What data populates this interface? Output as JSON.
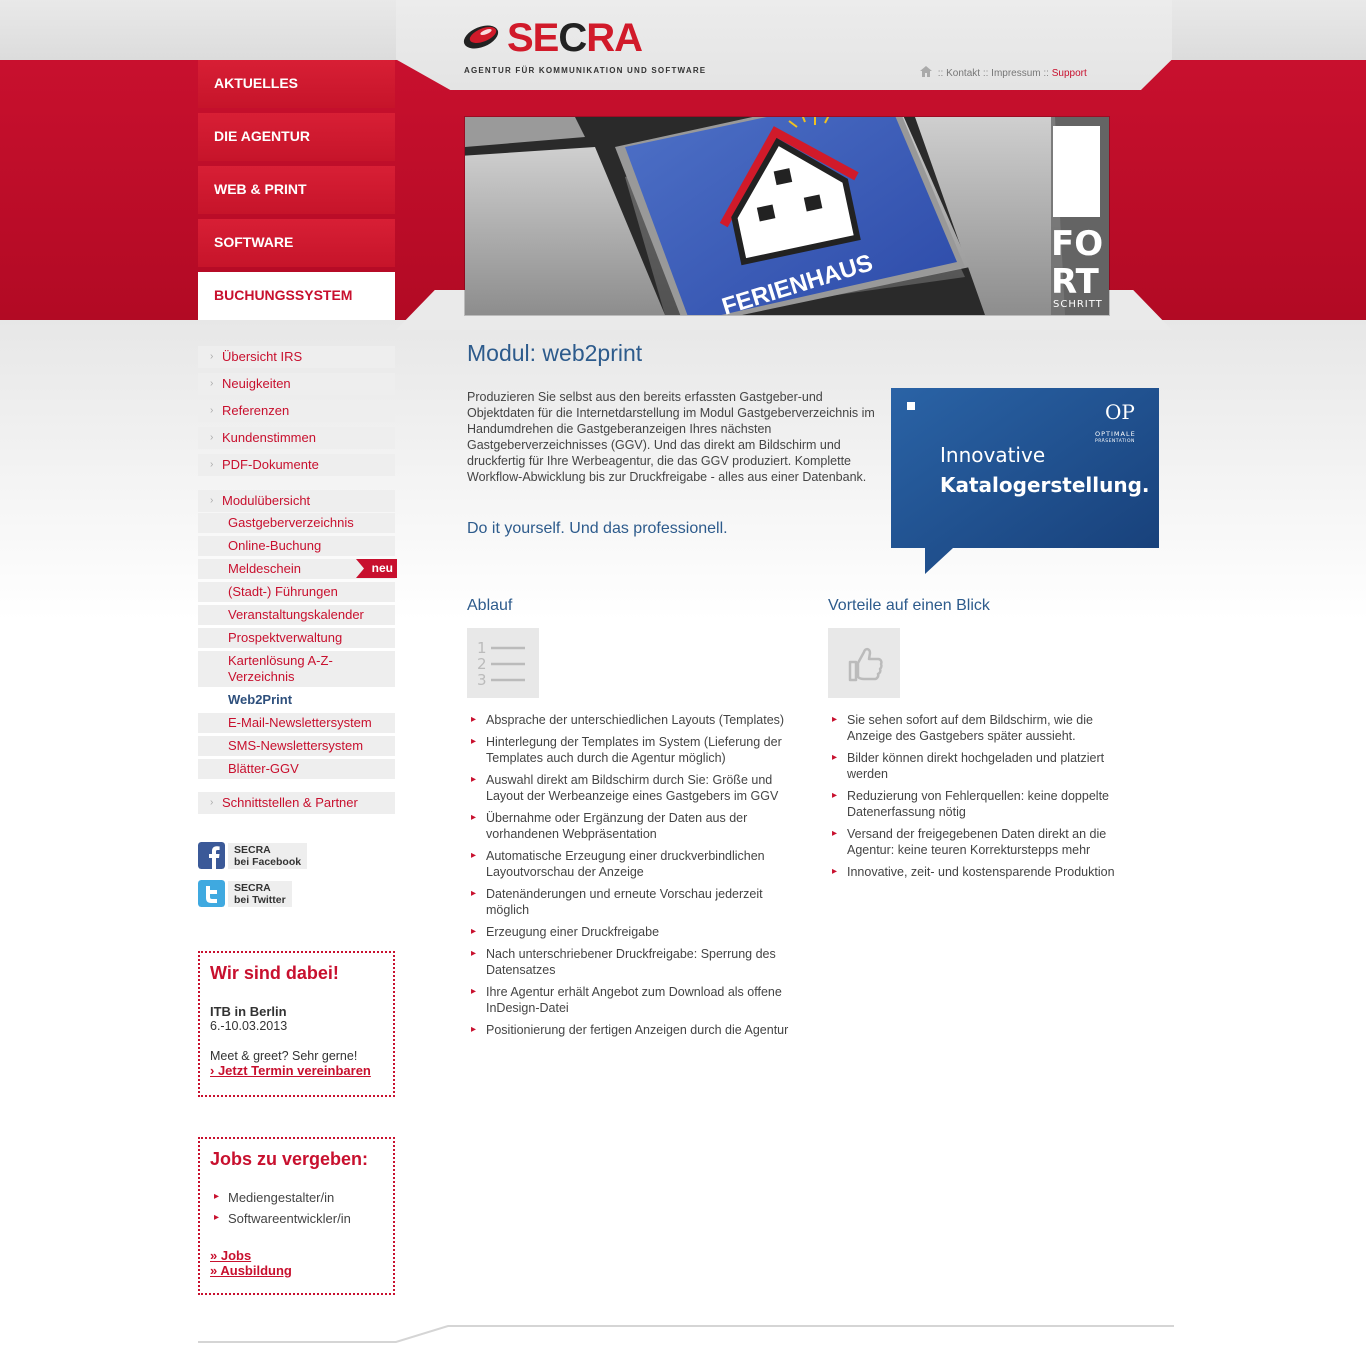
{
  "header": {
    "logo_text_red": "SE",
    "logo_text_dark": "C",
    "logo_text_red2": "RA",
    "logo_tagline": "AGENTUR FÜR KOMMUNIKATION UND SOFTWARE",
    "meta_sep": "::",
    "meta_links": [
      "Kontakt",
      "Impressum"
    ],
    "meta_support": "Support"
  },
  "main_nav": [
    {
      "label": "AKTUELLES"
    },
    {
      "label": "DIE AGENTUR"
    },
    {
      "label": "WEB & PRINT"
    },
    {
      "label": "SOFTWARE"
    },
    {
      "label": "BUCHUNGSSYSTEM",
      "active": true
    }
  ],
  "hero": {
    "key_text": "FERIENHAUS",
    "side_text_1": "FO",
    "side_text_2": "RT",
    "side_text_3": "SCHRITT"
  },
  "subnav": {
    "group1": [
      "Übersicht IRS",
      "Neuigkeiten",
      "Referenzen",
      "Kundenstimmen",
      "PDF-Dokumente"
    ],
    "group2_title": "Modulübersicht",
    "group2": [
      "Gastgeberverzeichnis",
      "Online-Buchung",
      "Meldeschein",
      "(Stadt-) Führungen",
      "Veranstaltungskalender",
      "Prospektverwaltung",
      "Kartenlösung A-Z-",
      "Verzeichnis",
      "Web2Print",
      "E-Mail-Newslettersystem",
      "SMS-Newslettersystem",
      "Blätter-GGV"
    ],
    "badge_new": "neu",
    "group3": "Schnittstellen & Partner"
  },
  "social": {
    "facebook_line1": "SECRA",
    "facebook_line2": "bei Facebook",
    "twitter_line1": "SECRA",
    "twitter_line2": "bei Twitter"
  },
  "event_box": {
    "title": "Wir sind dabei!",
    "event": "ITB in Berlin",
    "date": "6.-10.03.2013",
    "text": "Meet & greet? Sehr gerne!",
    "link": "› Jetzt Termin vereinbaren"
  },
  "jobs_box": {
    "title": "Jobs zu vergeben:",
    "items": [
      "Mediengestalter/in",
      "Softwareentwickler/in"
    ],
    "link_jobs": "» Jobs",
    "link_training": "» Ausbildung"
  },
  "content": {
    "title": "Modul: web2print",
    "intro": "Produzieren Sie selbst aus den bereits erfassten Gastgeber-und Objektdaten für die Internetdarstellung im Modul Gastgeberverzeichnis im Handumdrehen die Gastgeberanzeigen Ihres nächsten Gastgeberverzeichnisses (GGV). Und das direkt am Bildschirm und druckfertig für Ihre Werbeagentur, die das GGV produziert. Komplette Workflow-Abwicklung bis zur Druckfreigabe - alles aus einer Datenbank.",
    "tagline": "Do it yourself. Und das professionell.",
    "promo_line1": "Innovative",
    "promo_line2": "Katalogerstellung.",
    "promo_logo": "OP",
    "promo_logo_sub1": "OPTIMALE",
    "promo_logo_sub2": "PRÄSENTATION"
  },
  "ablauf": {
    "title": "Ablauf",
    "items": [
      "Absprache der unterschiedlichen Layouts (Templates)",
      "Hinterlegung der Templates im System (Lieferung der Templates auch durch die Agentur möglich)",
      "Auswahl direkt am Bildschirm durch Sie: Größe und Layout der Werbeanzeige eines Gastgebers im GGV",
      "Übernahme oder Ergänzung der Daten aus der vorhandenen Webpräsentation",
      "Automatische Erzeugung einer druckverbindlichen Layoutvorschau der Anzeige",
      "Datenänderungen und erneute Vorschau jederzeit möglich",
      "Erzeugung einer Druckfreigabe",
      "Nach unterschriebener Druckfreigabe: Sperrung des Datensatzes",
      "Ihre Agentur erhält Angebot zum Download als offene InDesign-Datei",
      "Positionierung der fertigen Anzeigen durch die Agentur"
    ]
  },
  "vorteile": {
    "title": "Vorteile auf einen Blick",
    "items": [
      "Sie sehen sofort auf dem Bildschirm, wie die Anzeige des Gastgebers später aussieht.",
      "Bilder können direkt hochgeladen und platziert werden",
      "Reduzierung von Fehlerquellen: keine doppelte Datenerfassung nötig",
      "Versand der freigegebenen Daten direkt an die Agentur: keine teuren Korrekturstepps mehr",
      "Innovative, zeit- und kostensparende Produktion"
    ]
  },
  "colors": {
    "brand_red": "#c8102e",
    "title_blue": "#2d5b8c",
    "promo_blue": "#1d4f8c"
  }
}
